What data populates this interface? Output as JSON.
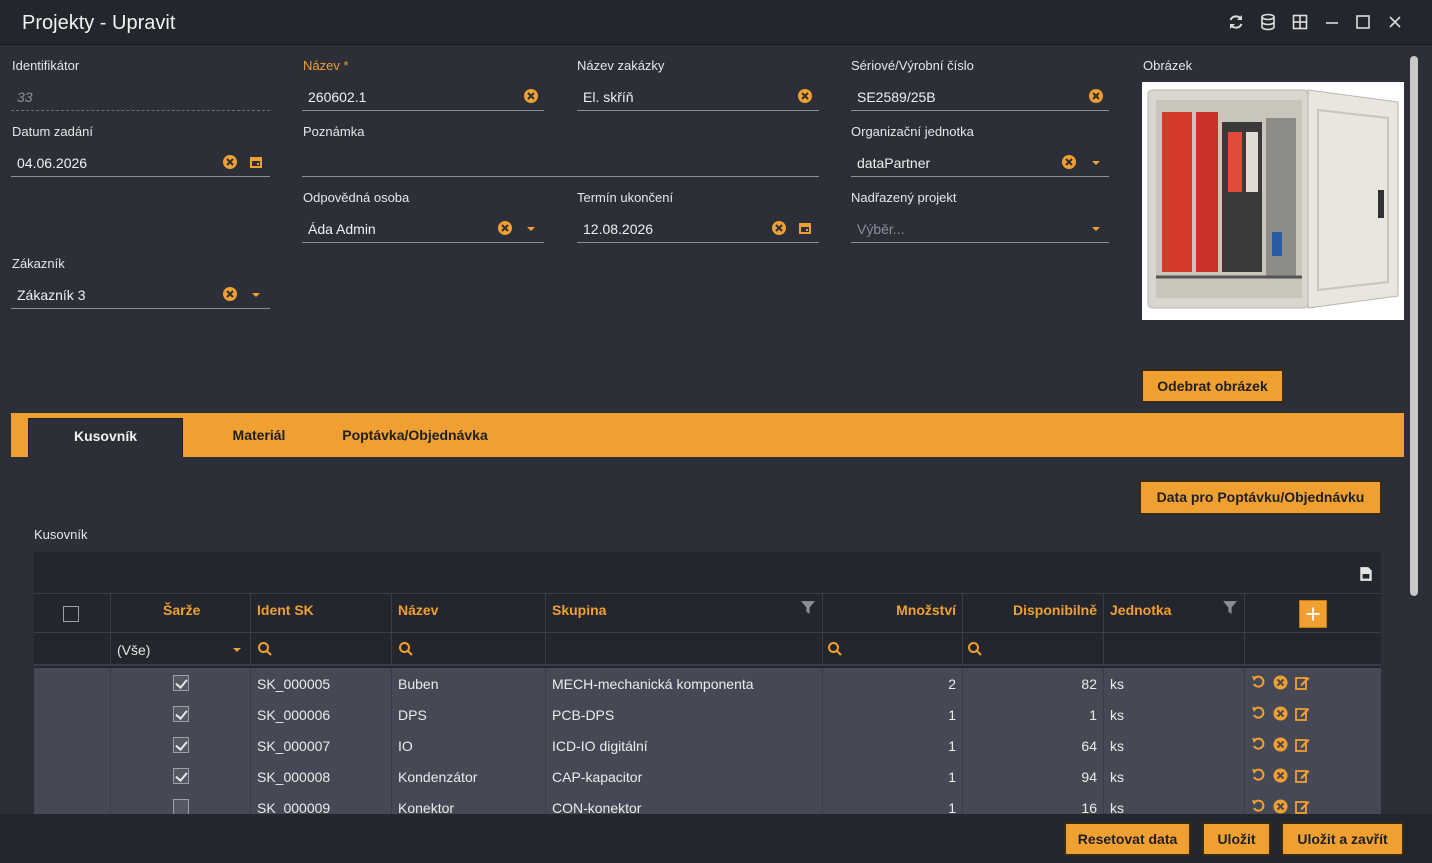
{
  "window": {
    "title": "Projekty - Upravit"
  },
  "form": {
    "identifikator": {
      "label": "Identifikátor",
      "value": "33"
    },
    "nazev": {
      "label": "Název *",
      "value": "260602.1"
    },
    "nazev_zakazky": {
      "label": "Název zakázky",
      "value": "El. skříň"
    },
    "seriove_cislo": {
      "label": "Sériové/Výrobní číslo",
      "value": "SE2589/25B"
    },
    "obrazek": {
      "label": "Obrázek"
    },
    "datum_zadani": {
      "label": "Datum zadání",
      "value": "04.06.2026"
    },
    "poznamka": {
      "label": "Poznámka",
      "value": ""
    },
    "organizacni_jednotka": {
      "label": "Organizační jednotka",
      "value": "dataPartner"
    },
    "odpovedna_osoba": {
      "label": "Odpovědná osoba",
      "value": "Áda Admin"
    },
    "termin_ukonceni": {
      "label": "Termín ukončení",
      "value": "12.08.2026"
    },
    "nadrazeny_projekt": {
      "label": "Nadřazený projekt",
      "placeholder": "Výběr..."
    },
    "zakaznik": {
      "label": "Zákazník",
      "value": "Zákazník 3"
    },
    "remove_image_button": "Odebrat obrázek"
  },
  "tabs": [
    {
      "label": "Kusovník",
      "active": true
    },
    {
      "label": "Materiál",
      "active": false
    },
    {
      "label": "Poptávka/Objednávka",
      "active": false
    }
  ],
  "kusovnik": {
    "data_button": "Data pro Poptávku/Objednávku",
    "section_label": "Kusovník",
    "columns": [
      "Šarže",
      "Ident SK",
      "Název",
      "Skupina",
      "Množství",
      "Disponibilně",
      "Jednotka"
    ],
    "sarze_filter": "(Vše)",
    "rows": [
      {
        "sarze": true,
        "ident": "SK_000005",
        "nazev": "Buben",
        "skupina": "MECH-mechanická komponenta",
        "mnozstvi": "2",
        "disponibilne": "82",
        "jednotka": "ks"
      },
      {
        "sarze": true,
        "ident": "SK_000006",
        "nazev": "DPS",
        "skupina": "PCB-DPS",
        "mnozstvi": "1",
        "disponibilne": "1",
        "jednotka": "ks"
      },
      {
        "sarze": true,
        "ident": "SK_000007",
        "nazev": "IO",
        "skupina": "ICD-IO digitální",
        "mnozstvi": "1",
        "disponibilne": "64",
        "jednotka": "ks"
      },
      {
        "sarze": true,
        "ident": "SK_000008",
        "nazev": "Kondenzátor",
        "skupina": "CAP-kapacitor",
        "mnozstvi": "1",
        "disponibilne": "94",
        "jednotka": "ks"
      },
      {
        "sarze": false,
        "ident": "SK_000009",
        "nazev": "Konektor",
        "skupina": "CON-konektor",
        "mnozstvi": "1",
        "disponibilne": "16",
        "jednotka": "ks"
      }
    ]
  },
  "footer": {
    "reset": "Resetovat data",
    "save": "Uložit",
    "save_close": "Uložit a zavřít"
  },
  "colors": {
    "accent": "#f0a030",
    "background": "#2c2f38",
    "titlebar": "#23262d",
    "row": "#464955"
  },
  "icons": [
    "refresh-icon",
    "database-icon",
    "layout-grid-icon",
    "minimize-icon",
    "maximize-icon",
    "close-icon",
    "clear-icon",
    "calendar-icon",
    "dropdown-arrow-icon",
    "filter-icon",
    "search-icon",
    "export-icon",
    "plus-icon",
    "undo-icon",
    "delete-icon",
    "edit-icon"
  ]
}
